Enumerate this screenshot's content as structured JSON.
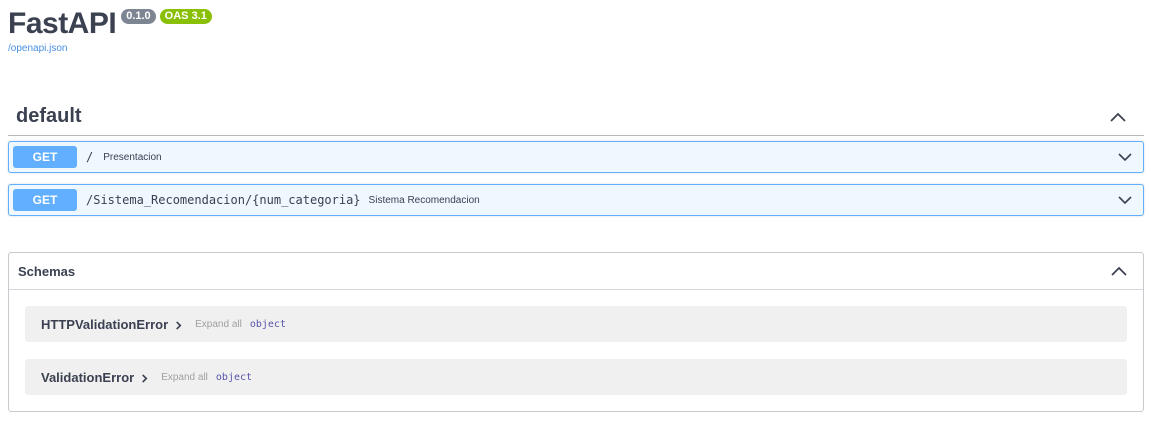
{
  "header": {
    "title": "FastAPI",
    "version_badge": "0.1.0",
    "oas_badge": "OAS 3.1",
    "spec_link": "/openapi.json"
  },
  "tag": {
    "name": "default",
    "operations": [
      {
        "method": "GET",
        "path": "/",
        "summary": "Presentacion"
      },
      {
        "method": "GET",
        "path": "/Sistema_Recomendacion/{num_categoria}",
        "summary": "Sistema Recomendacion"
      }
    ]
  },
  "schemas": {
    "title": "Schemas",
    "models": [
      {
        "name": "HTTPValidationError",
        "expand_label": "Expand all",
        "type": "object"
      },
      {
        "name": "ValidationError",
        "expand_label": "Expand all",
        "type": "object"
      }
    ]
  },
  "colors": {
    "get_method": "#61affe",
    "get_background": "#eff7ff",
    "version_badge": "#7d8492",
    "oas_badge": "#89bf04",
    "link": "#4990e2"
  }
}
